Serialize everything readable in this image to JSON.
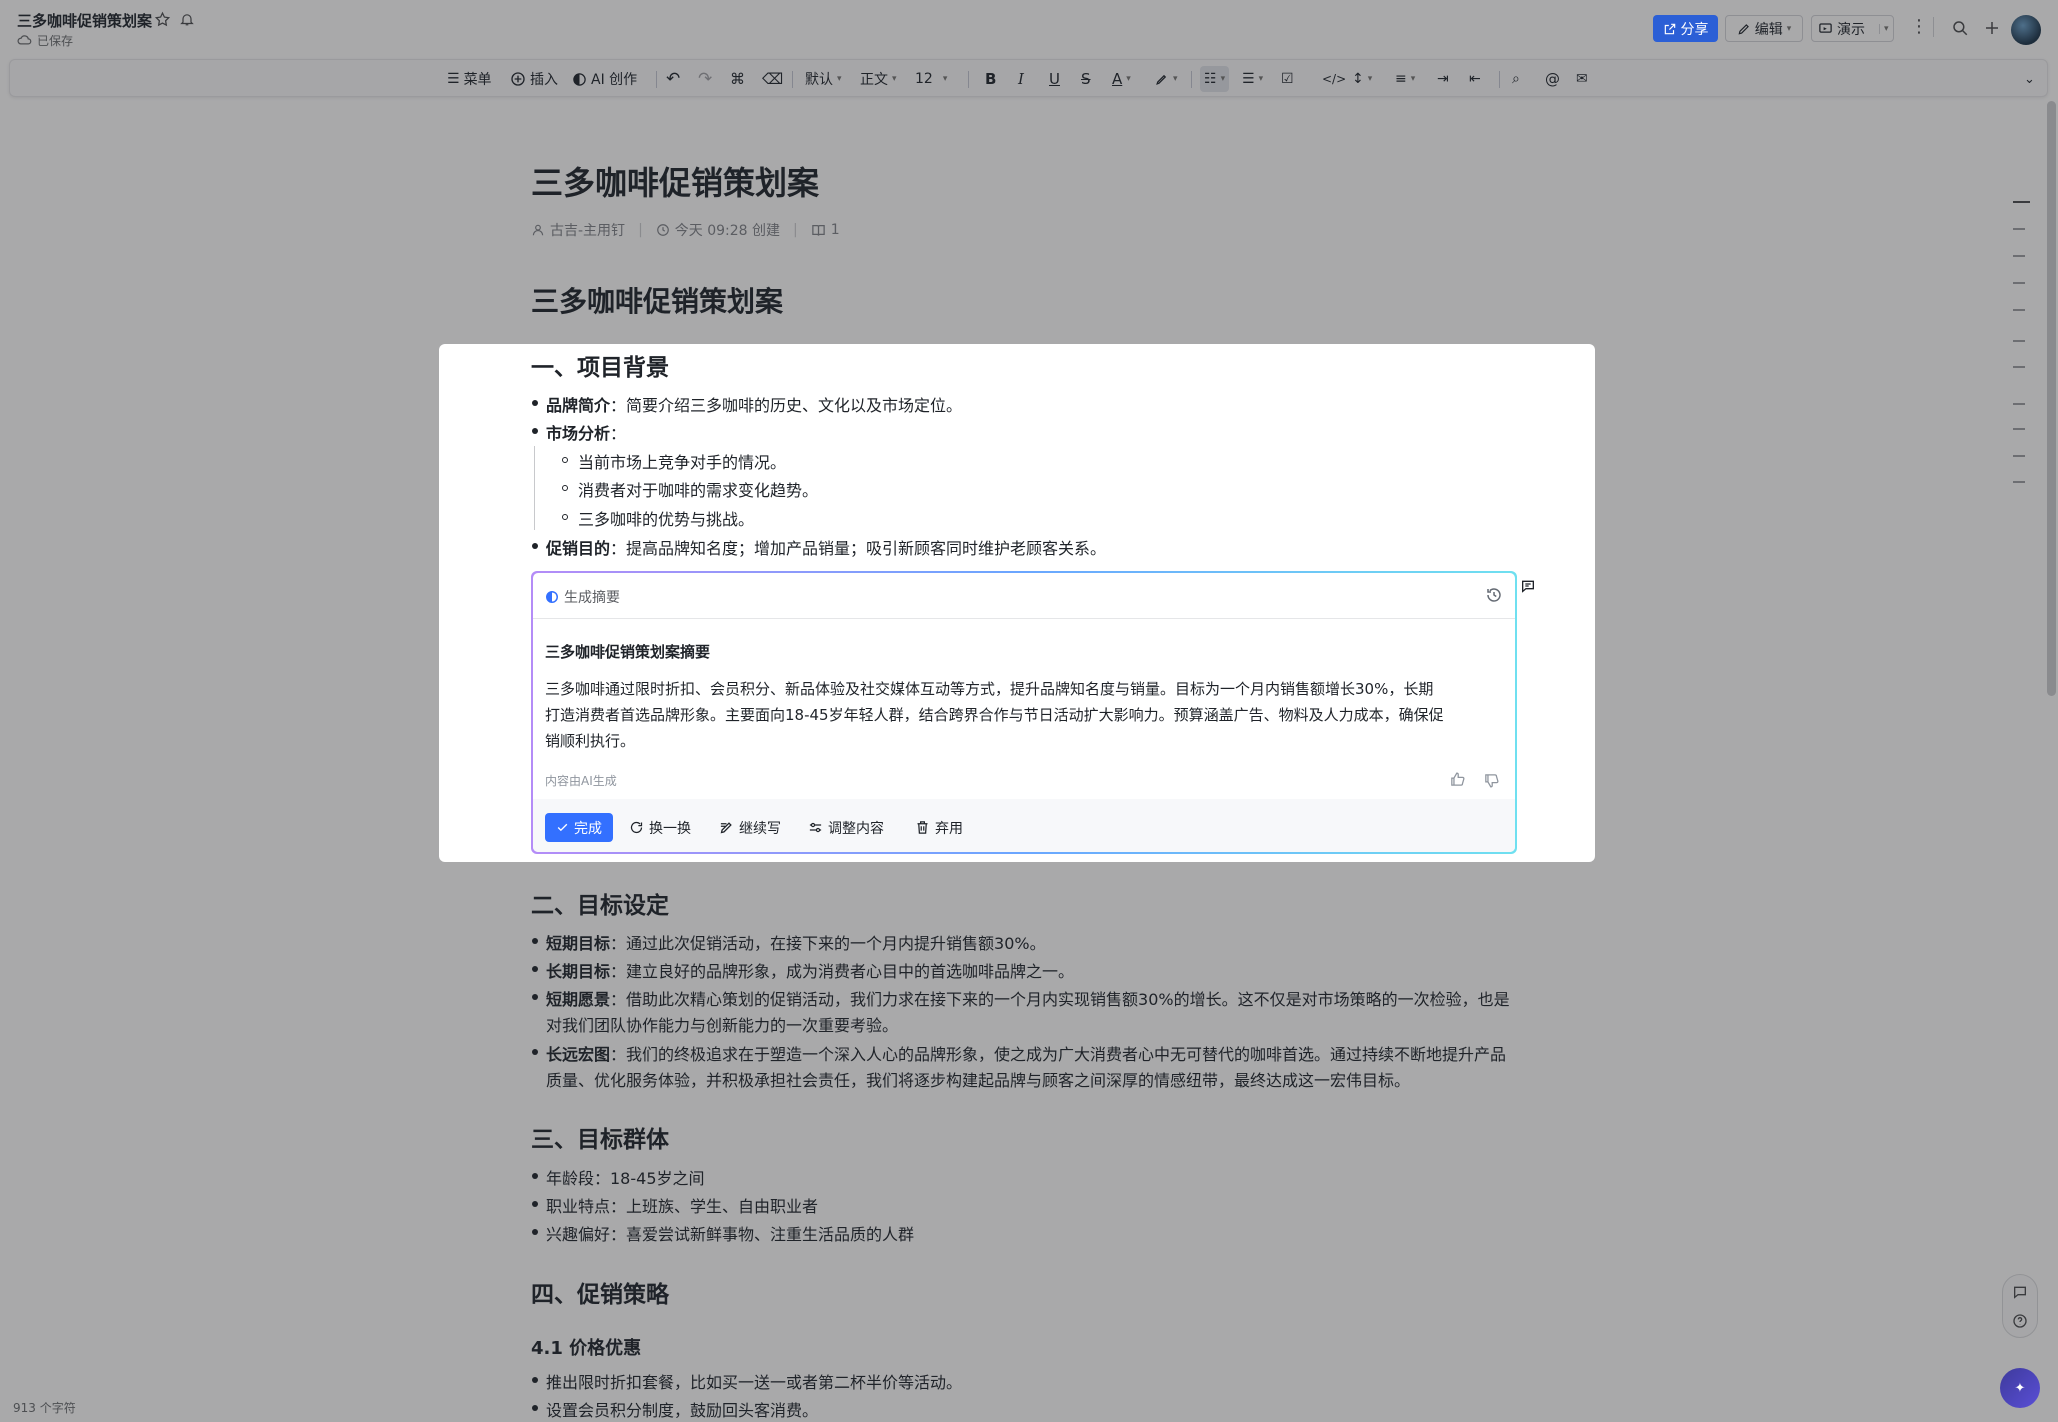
{
  "app": {
    "doc_title": "三多咖啡促销策划案",
    "saved_status": "已保存",
    "share_label": "分享",
    "edit_label": "编辑",
    "present_label": "演示",
    "char_count": "913 个字符"
  },
  "toolbar": {
    "menu": "菜单",
    "insert": "插入",
    "ai_create": "AI 创作",
    "style": "默认",
    "text_type": "正文",
    "font_size": "12",
    "bold": "B",
    "italic": "I",
    "underline": "U",
    "strike": "S",
    "font_color": "A"
  },
  "doc": {
    "title": "三多咖啡促销策划案",
    "author": "古吉-主用钉",
    "created": "今天 09:28 创建",
    "reads": "1",
    "heading": "三多咖啡促销策划案",
    "sec1": {
      "heading": "一、项目背景",
      "brand_label": "品牌简介",
      "brand_text": "：简要介绍三多咖啡的历史、文化以及市场定位。",
      "market_label": "市场分析",
      "market_colon": "：",
      "sub1": "当前市场上竞争对手的情况。",
      "sub2": "消费者对于咖啡的需求变化趋势。",
      "sub3": "三多咖啡的优势与挑战。",
      "goal_label": "促销目的",
      "goal_text": "：提高品牌知名度；增加产品销量；吸引新顾客同时维护老顾客关系。"
    },
    "ai": {
      "prompt": "生成摘要",
      "title": "三多咖啡促销策划案摘要",
      "line1": "三多咖啡通过限时折扣、会员积分、新品体验及社交媒体互动等方式，提升品牌知名度与销量。目标为一个月内销售额增长30%，长期",
      "line2": "打造消费者首选品牌形象。主要面向18-45岁年轻人群，结合跨界合作与节日活动扩大影响力。预算涵盖广告、物料及人力成本，确保促",
      "line3": "销顺利执行。",
      "note": "内容由AI生成",
      "done": "完成",
      "swap": "换一换",
      "continue": "继续写",
      "adjust": "调整内容",
      "discard": "弃用"
    },
    "sec2": {
      "heading": "二、目标设定",
      "short_label": "短期目标",
      "short_text": "：通过此次促销活动，在接下来的一个月内提升销售额30%。",
      "long_label": "长期目标",
      "long_text": "：建立良好的品牌形象，成为消费者心目中的首选咖啡品牌之一。",
      "vision_label": "短期愿景",
      "vision_text1": "：借助此次精心策划的促销活动，我们力求在接下来的一个月内实现销售额30%的增长。这不仅是对市场策略的一次检验，也是",
      "vision_text2": "对我们团队协作能力与创新能力的一次重要考验。",
      "grand_label": "长远宏图",
      "grand_text1": "：我们的终极追求在于塑造一个深入人心的品牌形象，使之成为广大消费者心中无可替代的咖啡首选。通过持续不断地提升产品",
      "grand_text2": "质量、优化服务体验，并积极承担社会责任，我们将逐步构建起品牌与顾客之间深厚的情感纽带，最终达成这一宏伟目标。"
    },
    "sec3": {
      "heading": "三、目标群体",
      "age": "年龄段：18-45岁之间",
      "job": "职业特点：上班族、学生、自由职业者",
      "hobby": "兴趣偏好：喜爱尝试新鲜事物、注重生活品质的人群"
    },
    "sec4": {
      "heading": "四、促销策略",
      "sub_heading": "4.1 价格优惠",
      "item1": "推出限时折扣套餐，比如买一送一或者第二杯半价等活动。",
      "item2": "设置会员积分制度，鼓励回头客消费。"
    }
  },
  "colors": {
    "accent": "#3370ff",
    "overlay": "#a9a9aa",
    "ai_gradient": [
      "#b48cf7",
      "#6aa6ff",
      "#6fe0f0"
    ]
  },
  "icons": [
    "star-icon",
    "bell-icon",
    "share-icon",
    "edit-icon",
    "present-icon",
    "more-icon",
    "search-icon",
    "plus-icon",
    "avatar",
    "menu-icon",
    "insert-icon",
    "ai-icon",
    "undo-icon",
    "redo-icon",
    "format-painter-icon",
    "eraser-icon",
    "highlight-icon",
    "bullet-list-icon",
    "numbered-list-icon",
    "checkbox-icon",
    "code-icon",
    "line-height-icon",
    "align-icon",
    "indent-icon",
    "outdent-icon",
    "find-icon",
    "mention-icon",
    "comment-icon",
    "collapse-icon",
    "history-icon",
    "thumb-up-icon",
    "thumb-down-icon",
    "check-icon",
    "refresh-icon",
    "pen-icon",
    "sliders-icon",
    "trash-icon",
    "help-icon",
    "ai-assistant-icon"
  ]
}
